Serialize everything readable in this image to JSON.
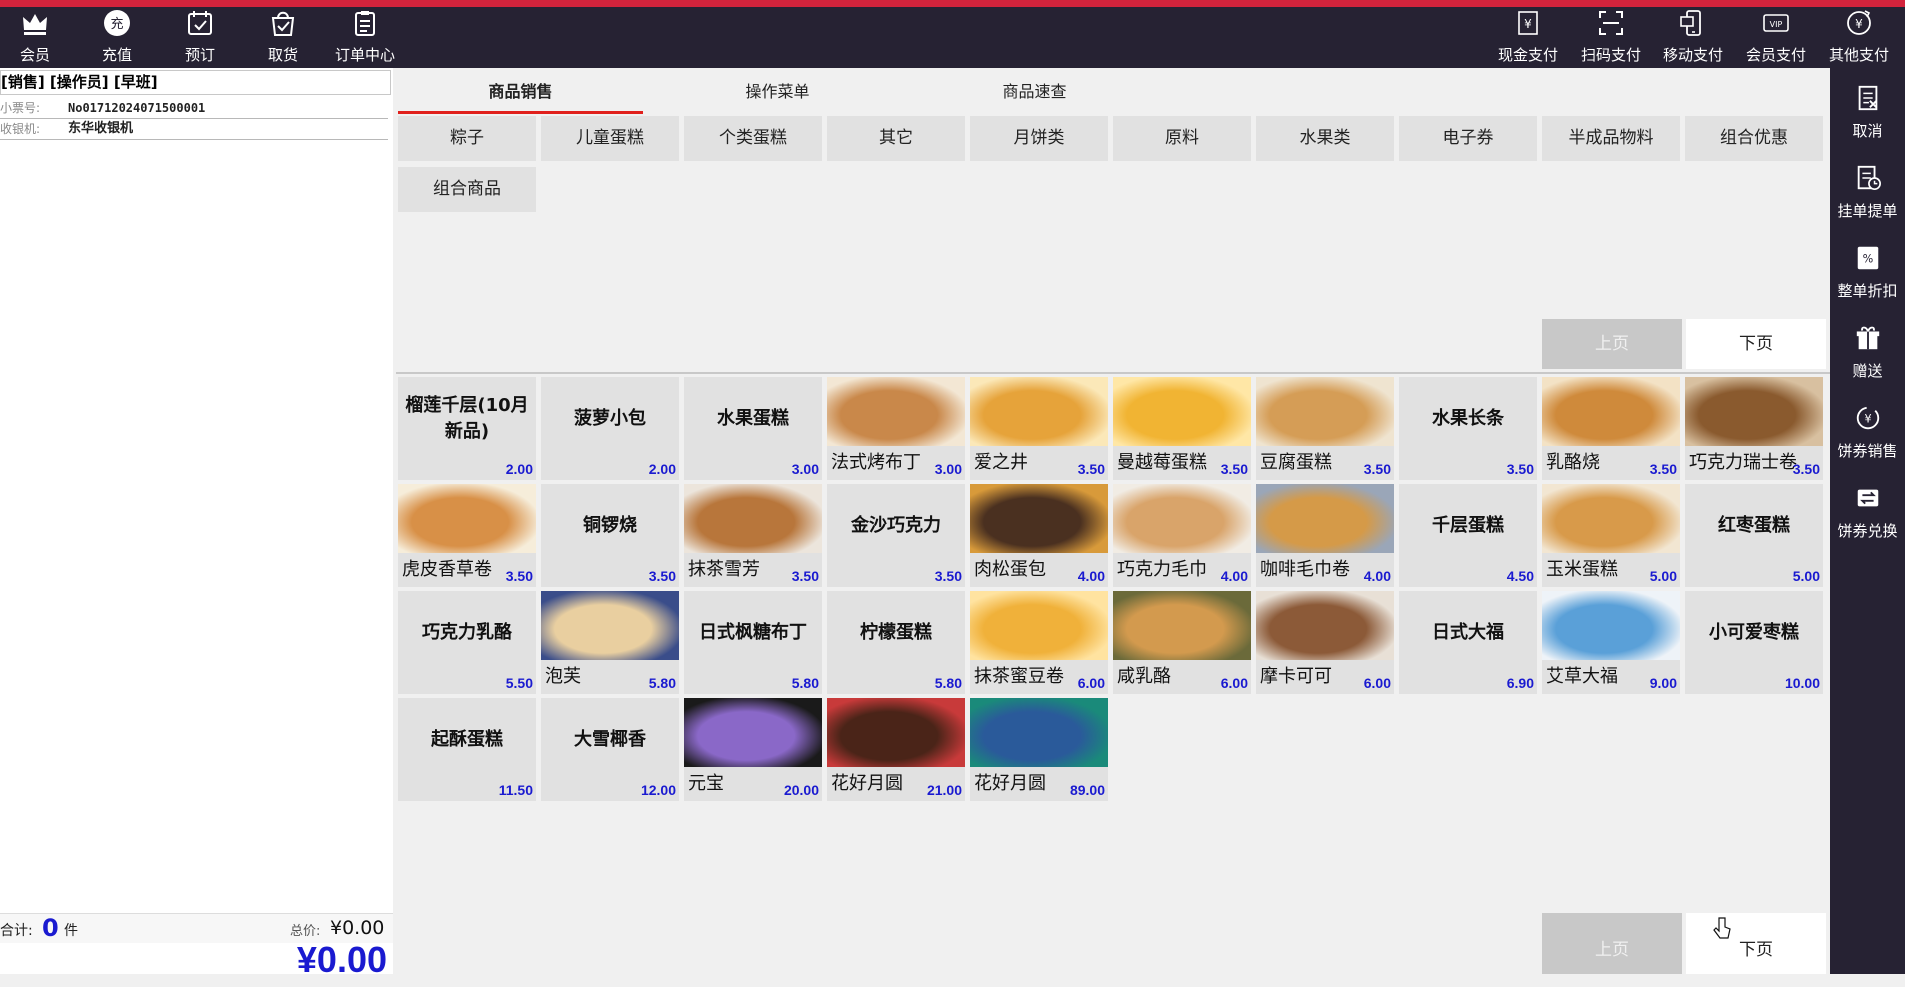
{
  "topbar": {
    "left": [
      {
        "label": "会员",
        "icon": "crown-icon"
      },
      {
        "label": "充值",
        "icon": "recharge-icon",
        "glyph": "充"
      },
      {
        "label": "预订",
        "icon": "calendar-check-icon"
      },
      {
        "label": "取货",
        "icon": "bag-check-icon"
      },
      {
        "label": "订单中心",
        "icon": "clipboard-icon"
      }
    ],
    "right": [
      {
        "label": "现金支付",
        "icon": "cash-icon"
      },
      {
        "label": "扫码支付",
        "icon": "scan-icon"
      },
      {
        "label": "移动支付",
        "icon": "mobile-pay-icon"
      },
      {
        "label": "会员支付",
        "icon": "vip-card-icon"
      },
      {
        "label": "其他支付",
        "icon": "other-pay-icon"
      }
    ]
  },
  "sidebar_right": [
    {
      "label": "取消",
      "icon": "cancel-doc-icon"
    },
    {
      "label": "挂单提单",
      "icon": "hold-order-icon"
    },
    {
      "label": "整单折扣",
      "icon": "discount-icon"
    },
    {
      "label": "赠送",
      "icon": "gift-icon"
    },
    {
      "label": "饼券销售",
      "icon": "voucher-sale-icon"
    },
    {
      "label": "饼券兑换",
      "icon": "voucher-exchange-icon"
    }
  ],
  "left_panel": {
    "header": "[销售] [操作员] [早班]",
    "ticket_label": "小票号:",
    "ticket_value": "No01712024071500001",
    "cashier_label": "收银机:",
    "cashier_value": "东华收银机",
    "total_label": "合计:",
    "total_count": "0",
    "total_unit": "件",
    "total_price_label": "总价:",
    "total_price": "¥0.00",
    "grand_total": "¥0.00"
  },
  "tabs": [
    {
      "label": "商品销售",
      "active": true
    },
    {
      "label": "操作菜单",
      "active": false
    },
    {
      "label": "商品速查",
      "active": false
    }
  ],
  "categories": [
    "粽子",
    "儿童蛋糕",
    "个类蛋糕",
    "其它",
    "月饼类",
    "原料",
    "水果类",
    "电子券",
    "半成品物料",
    "组合优惠",
    "组合商品"
  ],
  "paging": {
    "prev": "上页",
    "next": "下页"
  },
  "products": [
    {
      "name": "榴莲千层(10月新品)",
      "price": "2.00",
      "img": false
    },
    {
      "name": "菠萝小包",
      "price": "2.00",
      "img": false
    },
    {
      "name": "水果蛋糕",
      "price": "3.00",
      "img": false
    },
    {
      "name": "法式烤布丁",
      "price": "3.00",
      "img": true,
      "c1": "#c9884a",
      "c2": "#f3e7d4"
    },
    {
      "name": "爱之井",
      "price": "3.50",
      "img": true,
      "c1": "#e6a33a",
      "c2": "#fbe8b8"
    },
    {
      "name": "曼越莓蛋糕",
      "price": "3.50",
      "img": true,
      "c1": "#f1b433",
      "c2": "#ffe7a6"
    },
    {
      "name": "豆腐蛋糕",
      "price": "3.50",
      "img": true,
      "c1": "#d59d56",
      "c2": "#efe4d0"
    },
    {
      "name": "水果长条",
      "price": "3.50",
      "img": false
    },
    {
      "name": "乳酪烧",
      "price": "3.50",
      "img": true,
      "c1": "#cf8a3b",
      "c2": "#f3e2c5"
    },
    {
      "name": "巧克力瑞士卷",
      "price": "3.50",
      "img": true,
      "c1": "#8a5a2e",
      "c2": "#d8c0a0"
    },
    {
      "name": "虎皮香草卷",
      "price": "3.50",
      "img": true,
      "c1": "#d89047",
      "c2": "#f6edda"
    },
    {
      "name": "铜锣烧",
      "price": "3.50",
      "img": false
    },
    {
      "name": "抹茶雪芳",
      "price": "3.50",
      "img": true,
      "c1": "#b8763b",
      "c2": "#ece5dc"
    },
    {
      "name": "金沙巧克力",
      "price": "3.50",
      "img": false
    },
    {
      "name": "肉松蛋包",
      "price": "4.00",
      "img": true,
      "c1": "#4a3020",
      "c2": "#d89a3a"
    },
    {
      "name": "巧克力毛巾",
      "price": "4.00",
      "img": true,
      "c1": "#d9a46a",
      "c2": "#f1ece4"
    },
    {
      "name": "咖啡毛巾卷",
      "price": "4.00",
      "img": true,
      "c1": "#d59a48",
      "c2": "#9aa6b8"
    },
    {
      "name": "千层蛋糕",
      "price": "4.50",
      "img": false
    },
    {
      "name": "玉米蛋糕",
      "price": "5.00",
      "img": true,
      "c1": "#d89a4a",
      "c2": "#f2e6d2"
    },
    {
      "name": "红枣蛋糕",
      "price": "5.00",
      "img": false
    },
    {
      "name": "巧克力乳酪",
      "price": "5.50",
      "img": false
    },
    {
      "name": "泡芙",
      "price": "5.80",
      "img": true,
      "c1": "#e9cfa0",
      "c2": "#3a4d8a"
    },
    {
      "name": "日式枫糖布丁",
      "price": "5.80",
      "img": false
    },
    {
      "name": "柠檬蛋糕",
      "price": "5.80",
      "img": false
    },
    {
      "name": "抹茶蜜豆卷",
      "price": "6.00",
      "img": true,
      "c1": "#f0b13a",
      "c2": "#ffe3a0"
    },
    {
      "name": "咸乳酪",
      "price": "6.00",
      "img": true,
      "c1": "#d39a4e",
      "c2": "#6b6a3a"
    },
    {
      "name": "摩卡可可",
      "price": "6.00",
      "img": true,
      "c1": "#8c5a38",
      "c2": "#e8e0d6"
    },
    {
      "name": "日式大福",
      "price": "6.90",
      "img": false
    },
    {
      "name": "艾草大福",
      "price": "9.00",
      "img": true,
      "c1": "#5aa0d8",
      "c2": "#eef3f8"
    },
    {
      "name": "小可爱枣糕",
      "price": "10.00",
      "img": false
    },
    {
      "name": "起酥蛋糕",
      "price": "11.50",
      "img": false
    },
    {
      "name": "大雪椰香",
      "price": "12.00",
      "img": false
    },
    {
      "name": "元宝",
      "price": "20.00",
      "img": true,
      "c1": "#8a68c8",
      "c2": "#1a1a1a"
    },
    {
      "name": "花好月圆",
      "price": "21.00",
      "img": true,
      "c1": "#4a2418",
      "c2": "#c83a3a"
    },
    {
      "name": "花好月圆",
      "price": "89.00",
      "img": true,
      "c1": "#2a5a9a",
      "c2": "#1a8a7a"
    }
  ]
}
